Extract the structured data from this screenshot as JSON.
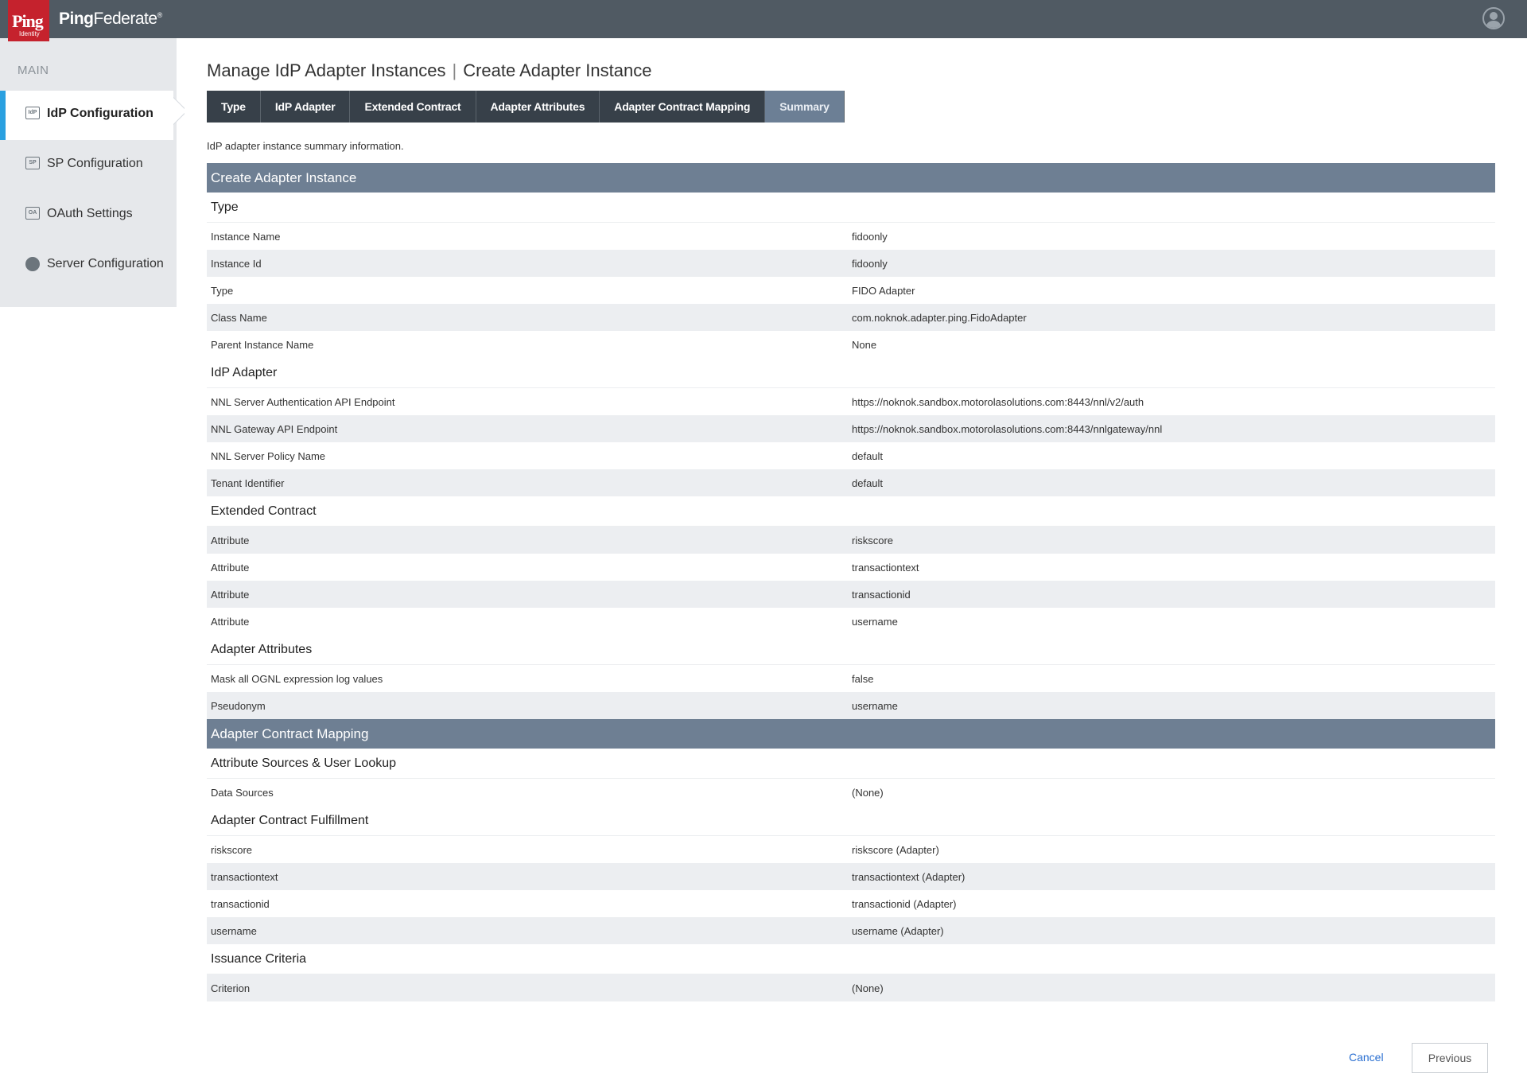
{
  "header": {
    "logo_text": "Ping",
    "logo_sub": "Identity",
    "product_name_a": "Ping",
    "product_name_b": "Federate",
    "trademark": "®"
  },
  "sidebar": {
    "section_label": "MAIN",
    "items": [
      {
        "icon": "IdP",
        "label": "IdP Configuration",
        "active": true
      },
      {
        "icon": "SP",
        "label": "SP Configuration",
        "active": false
      },
      {
        "icon": "OA",
        "label": "OAuth Settings",
        "active": false
      },
      {
        "icon": "server",
        "label": "Server Configuration",
        "active": false
      }
    ]
  },
  "page": {
    "title_left": "Manage IdP Adapter Instances",
    "title_sep": "|",
    "title_right": "Create Adapter Instance",
    "intro": "IdP adapter instance summary information."
  },
  "tabs": [
    {
      "label": "Type"
    },
    {
      "label": "IdP Adapter"
    },
    {
      "label": "Extended Contract"
    },
    {
      "label": "Adapter Attributes"
    },
    {
      "label": "Adapter Contract Mapping"
    },
    {
      "label": "Summary",
      "current": true
    }
  ],
  "summary": {
    "section1": "Create Adapter Instance",
    "type_group": "Type",
    "type_rows": [
      {
        "k": "Instance Name",
        "v": "fidoonly"
      },
      {
        "k": "Instance Id",
        "v": "fidoonly"
      },
      {
        "k": "Type",
        "v": "FIDO Adapter"
      },
      {
        "k": "Class Name",
        "v": "com.noknok.adapter.ping.FidoAdapter"
      },
      {
        "k": "Parent Instance Name",
        "v": "None"
      }
    ],
    "idp_group": "IdP Adapter",
    "idp_rows": [
      {
        "k": "NNL Server Authentication API Endpoint",
        "v": "https://noknok.sandbox.motorolasolutions.com:8443/nnl/v2/auth"
      },
      {
        "k": "NNL Gateway API Endpoint",
        "v": "https://noknok.sandbox.motorolasolutions.com:8443/nnlgateway/nnl"
      },
      {
        "k": "NNL Server Policy Name",
        "v": "default"
      },
      {
        "k": "Tenant Identifier",
        "v": "default"
      }
    ],
    "ext_group": "Extended Contract",
    "ext_rows": [
      {
        "k": "Attribute",
        "v": "riskscore"
      },
      {
        "k": "Attribute",
        "v": "transactiontext"
      },
      {
        "k": "Attribute",
        "v": "transactionid"
      },
      {
        "k": "Attribute",
        "v": "username"
      }
    ],
    "attr_group": "Adapter Attributes",
    "attr_rows": [
      {
        "k": "Mask all OGNL expression log values",
        "v": "false"
      },
      {
        "k": "Pseudonym",
        "v": "username"
      }
    ],
    "section2": "Adapter Contract Mapping",
    "src_group": "Attribute Sources & User Lookup",
    "src_rows": [
      {
        "k": "Data Sources",
        "v": "(None)"
      }
    ],
    "ful_group": "Adapter Contract Fulfillment",
    "ful_rows": [
      {
        "k": "riskscore",
        "v": "riskscore (Adapter)"
      },
      {
        "k": "transactiontext",
        "v": "transactiontext (Adapter)"
      },
      {
        "k": "transactionid",
        "v": "transactionid (Adapter)"
      },
      {
        "k": "username",
        "v": "username (Adapter)"
      }
    ],
    "iss_group": "Issuance Criteria",
    "iss_rows": [
      {
        "k": "Criterion",
        "v": "(None)"
      }
    ]
  },
  "footer": {
    "cancel": "Cancel",
    "previous": "Previous"
  }
}
